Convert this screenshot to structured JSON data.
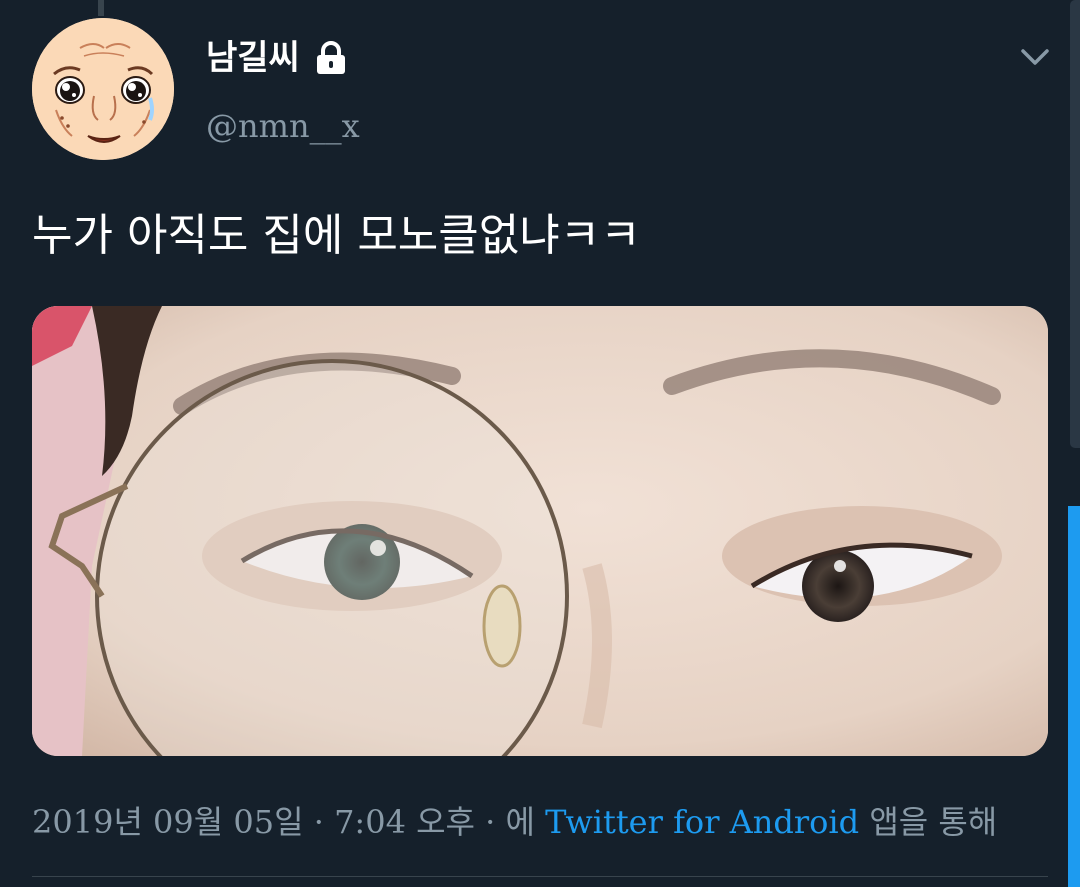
{
  "tweet": {
    "author": {
      "display_name": "남길씨",
      "handle": "@nmn__x",
      "protected": true
    },
    "text": "누가 아직도 집에 모노클없냐ㅋㅋ",
    "meta": {
      "date": "2019년 09월 05일",
      "separator": "·",
      "time": "7:04 오후",
      "via_prefix": "에",
      "source": "Twitter for Android",
      "via_suffix": "앱을 통해"
    }
  },
  "icons": {
    "lock": "lock-icon",
    "menu": "chevron-down-icon"
  },
  "colors": {
    "background": "#15202b",
    "secondary_text": "#8899a6",
    "link": "#1d9bf0",
    "divider": "#38444d"
  }
}
